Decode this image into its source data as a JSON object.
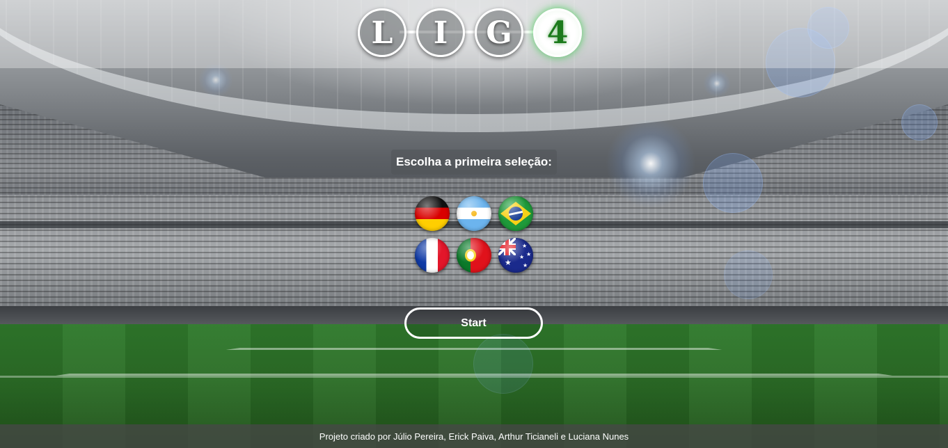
{
  "logo": {
    "letters": [
      "L",
      "I",
      "G",
      "4"
    ]
  },
  "prompt": {
    "text": "Escolha a primeira seleção:"
  },
  "flags": [
    {
      "country": "Alemanha",
      "icon": "germany-flag-icon"
    },
    {
      "country": "Argentina",
      "icon": "argentina-flag-icon"
    },
    {
      "country": "Brasil",
      "icon": "brazil-flag-icon"
    },
    {
      "country": "França",
      "icon": "france-flag-icon"
    },
    {
      "country": "Portugal",
      "icon": "portugal-flag-icon"
    },
    {
      "country": "Austrália",
      "icon": "australia-flag-icon"
    }
  ],
  "start_button": {
    "label": "Start"
  },
  "footer": {
    "text": "Projeto criado por Júlio Pereira, Erick Paiva, Arthur Ticianeli e Luciana Nunes"
  },
  "colors": {
    "accent_green": "#1c7a1c",
    "header_overlay": "rgba(255,255,255,0.32)",
    "footer_overlay": "rgba(70,72,70,0.78)"
  }
}
